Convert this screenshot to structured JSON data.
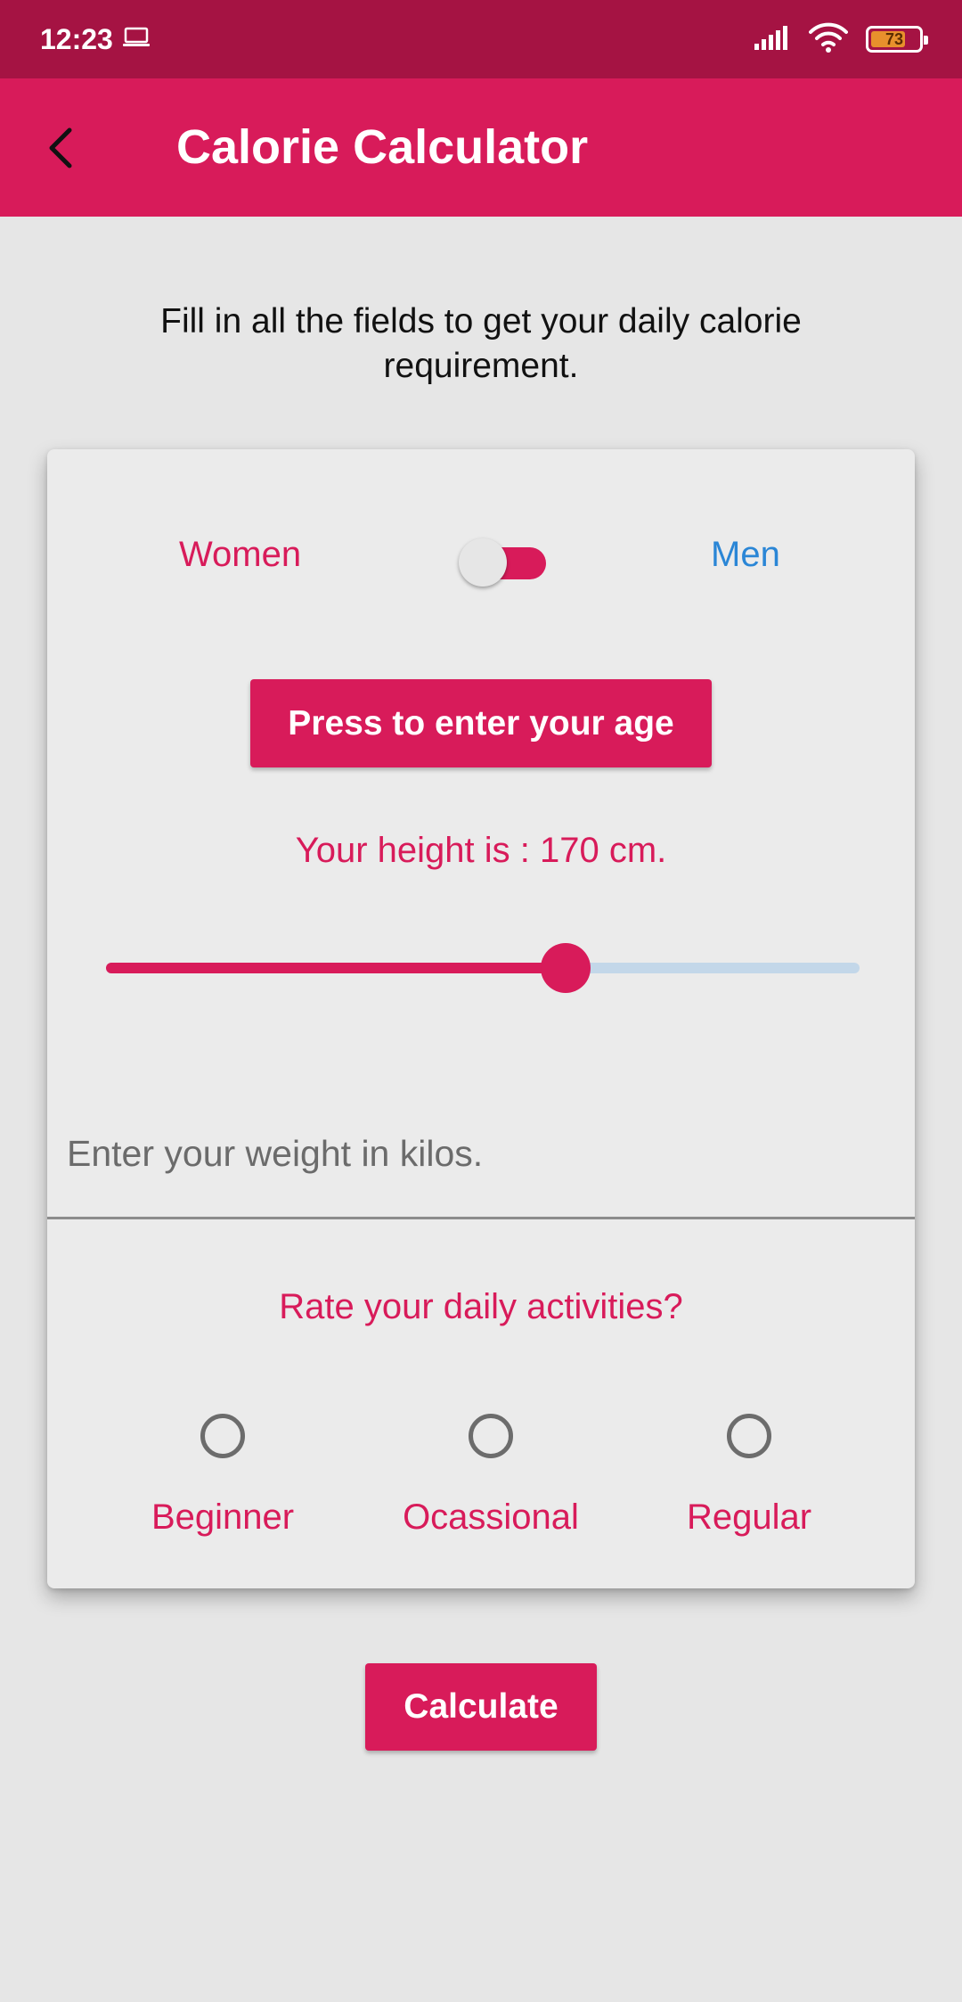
{
  "status_bar": {
    "time": "12:23",
    "battery_level": "73",
    "icons": [
      "laptop-icon",
      "signal-icon",
      "wifi-icon",
      "battery-icon"
    ]
  },
  "app_bar": {
    "title": "Calorie Calculator",
    "back_icon": "back-arrow-icon"
  },
  "intro_text": "Fill in all the fields to get your daily calorie requirement.",
  "gender": {
    "women_label": "Women",
    "men_label": "Men",
    "selected": "women"
  },
  "age_button_label": "Press to enter your age",
  "height": {
    "text": "Your height is : 170 cm.",
    "slider_fraction": 0.61
  },
  "weight": {
    "placeholder": "Enter your weight in kilos.",
    "value": ""
  },
  "activities": {
    "title": "Rate your daily activities?",
    "options": [
      {
        "label": "Beginner",
        "selected": false
      },
      {
        "label": "Ocassional",
        "selected": false
      },
      {
        "label": "Regular",
        "selected": false
      }
    ]
  },
  "calculate_label": "Calculate",
  "colors": {
    "status_bar": "#a51343",
    "accent": "#d81b5a",
    "men_label": "#2a86d6",
    "slider_inactive": "#c3d7e9",
    "background": "#e6e6e6",
    "card": "#ebebeb"
  }
}
